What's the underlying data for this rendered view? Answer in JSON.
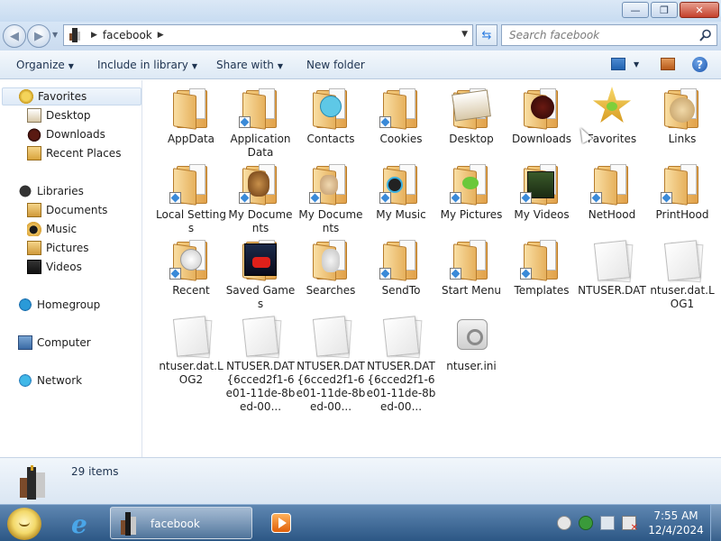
{
  "window": {
    "buttons": {
      "minimize": "—",
      "maximize": "❐",
      "close": "✕"
    }
  },
  "address": {
    "location": "facebook",
    "search_placeholder": "Search facebook"
  },
  "toolbar": {
    "organize": "Organize",
    "include_in_library": "Include in library",
    "share_with": "Share with",
    "new_folder": "New folder",
    "help": "?"
  },
  "nav": {
    "favorites": "Favorites",
    "desktop": "Desktop",
    "downloads": "Downloads",
    "recent_places": "Recent Places",
    "libraries": "Libraries",
    "documents": "Documents",
    "music": "Music",
    "pictures": "Pictures",
    "videos": "Videos",
    "homegroup": "Homegroup",
    "computer": "Computer",
    "network": "Network"
  },
  "files": [
    {
      "name": "AppData",
      "kind": "folder"
    },
    {
      "name": "Application Data",
      "kind": "folder-shortcut"
    },
    {
      "name": "Contacts",
      "kind": "folder"
    },
    {
      "name": "Cookies",
      "kind": "folder-shortcut"
    },
    {
      "name": "Desktop",
      "kind": "folder"
    },
    {
      "name": "Downloads",
      "kind": "folder"
    },
    {
      "name": "Favorites",
      "kind": "favorites"
    },
    {
      "name": "Links",
      "kind": "folder"
    },
    {
      "name": "Local Settings",
      "kind": "folder-shortcut"
    },
    {
      "name": "My Documents",
      "kind": "folder-shortcut"
    },
    {
      "name": "My Documents",
      "kind": "folder-shortcut"
    },
    {
      "name": "My Music",
      "kind": "folder-shortcut"
    },
    {
      "name": "My Pictures",
      "kind": "folder-shortcut"
    },
    {
      "name": "My Videos",
      "kind": "folder-shortcut"
    },
    {
      "name": "NetHood",
      "kind": "folder-shortcut"
    },
    {
      "name": "PrintHood",
      "kind": "folder-shortcut"
    },
    {
      "name": "Recent",
      "kind": "folder-shortcut"
    },
    {
      "name": "Saved Games",
      "kind": "folder"
    },
    {
      "name": "Searches",
      "kind": "folder"
    },
    {
      "name": "SendTo",
      "kind": "folder-shortcut"
    },
    {
      "name": "Start Menu",
      "kind": "folder-shortcut"
    },
    {
      "name": "Templates",
      "kind": "folder-shortcut"
    },
    {
      "name": "NTUSER.DAT",
      "kind": "file"
    },
    {
      "name": "ntuser.dat.LOG1",
      "kind": "file"
    },
    {
      "name": "ntuser.dat.LOG2",
      "kind": "file"
    },
    {
      "name": "NTUSER.DAT{6cced2f1-6e01-11de-8bed-00...",
      "kind": "file"
    },
    {
      "name": "NTUSER.DAT{6cced2f1-6e01-11de-8bed-00...",
      "kind": "file"
    },
    {
      "name": "NTUSER.DAT{6cced2f1-6e01-11de-8bed-00...",
      "kind": "file"
    },
    {
      "name": "ntuser.ini",
      "kind": "ini"
    }
  ],
  "status": {
    "items_count": "29 items"
  },
  "taskbar": {
    "explorer_label": "facebook",
    "time": "7:55 AM",
    "date": "12/4/2024"
  },
  "colors": {
    "selection": "#dfeaf7",
    "taskbar": "#2c5785",
    "folder": "#e1a14a"
  }
}
